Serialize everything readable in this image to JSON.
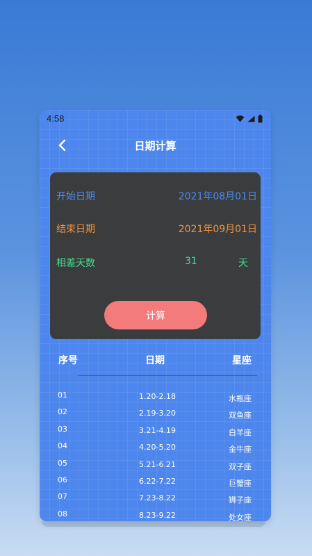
{
  "status": {
    "time": "4:58"
  },
  "nav": {
    "title": "日期计算"
  },
  "calc": {
    "start_label": "开始日期",
    "start_value": "2021年08月01日",
    "end_label": "结束日期",
    "end_value": "2021年09月01日",
    "diff_label": "相差天数",
    "diff_value": "31",
    "diff_unit": "天",
    "button_label": "计算"
  },
  "table": {
    "headers": [
      "序号",
      "日期",
      "星座"
    ],
    "rows": [
      [
        "01",
        "1.20-2.18",
        "水瓶座"
      ],
      [
        "02",
        "2.19-3.20",
        "双鱼座"
      ],
      [
        "03",
        "3.21-4.19",
        "白羊座"
      ],
      [
        "04",
        "4.20-5.20",
        "金牛座"
      ],
      [
        "05",
        "5.21-6.21",
        "双子座"
      ],
      [
        "06",
        "6.22-7.22",
        "巨蟹座"
      ],
      [
        "07",
        "7.23-8.22",
        "狮子座"
      ],
      [
        "08",
        "8.23-9.22",
        "处女座"
      ]
    ]
  },
  "colors": {
    "start": "#4b8cf0",
    "end": "#f4933c",
    "diff": "#44dd93",
    "button": "#f47b7b",
    "card": "#3b3c3e",
    "screen": "#4d86ec"
  }
}
